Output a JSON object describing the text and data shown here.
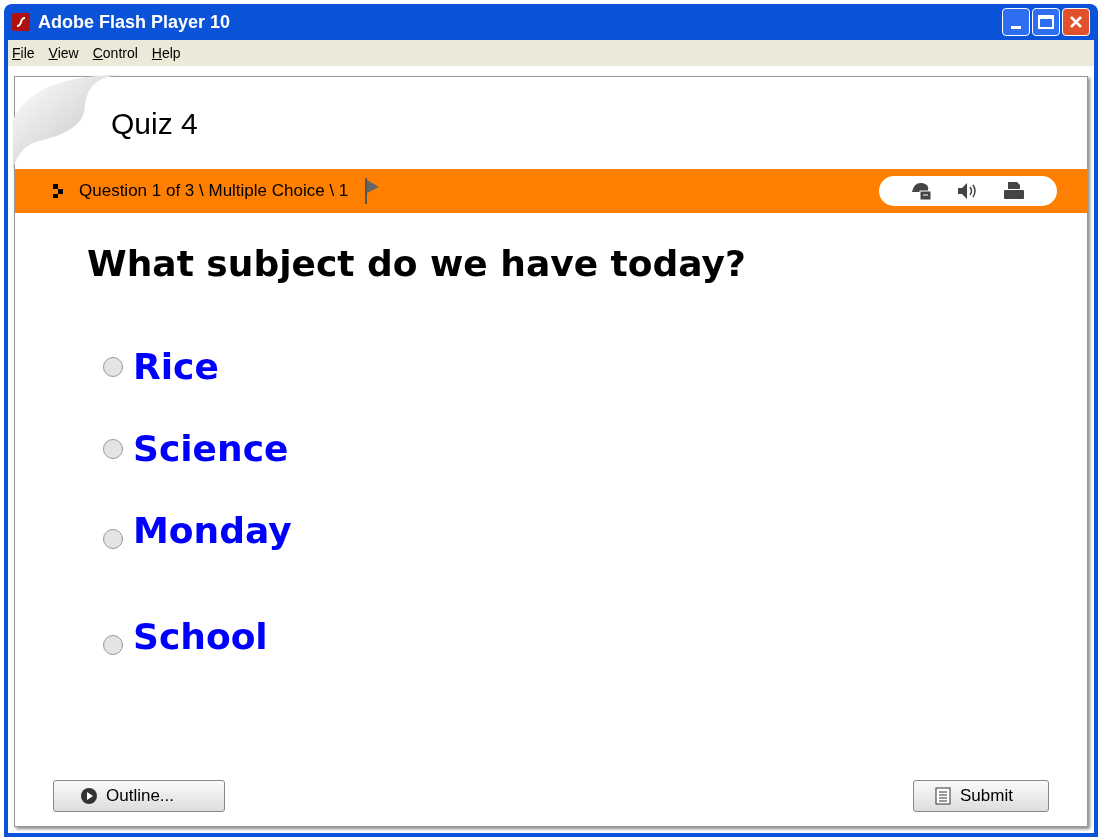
{
  "window": {
    "title": "Adobe Flash Player 10"
  },
  "menu": [
    "File",
    "View",
    "Control",
    "Help"
  ],
  "quiz": {
    "title": "Quiz 4",
    "breadcrumb": "Question 1 of 3 \\ Multiple Choice \\ 1",
    "question": "What subject do we have today?",
    "options": [
      {
        "label": "Rice",
        "selected": false
      },
      {
        "label": "Science",
        "selected": false
      },
      {
        "label": "Monday",
        "selected": false
      },
      {
        "label": "School",
        "selected": false
      }
    ]
  },
  "buttons": {
    "outline": "Outline...",
    "submit": "Submit"
  }
}
